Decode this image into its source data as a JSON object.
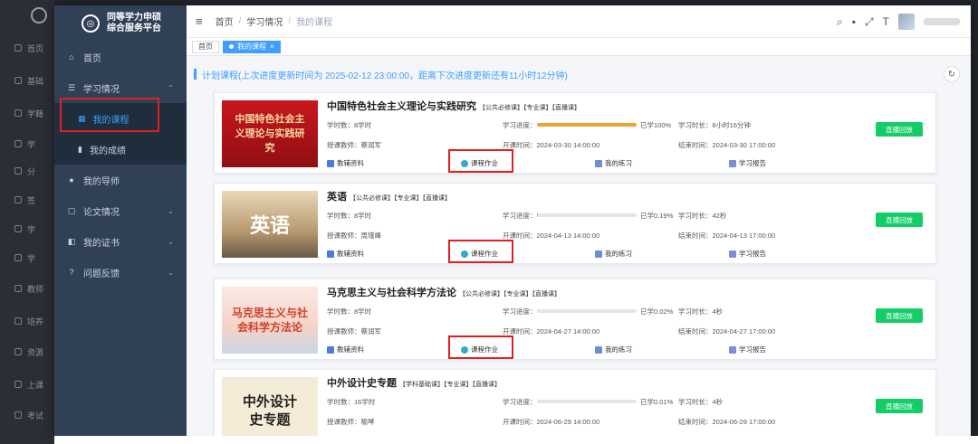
{
  "bg_sidebar": {
    "items": [
      "首页",
      "基础",
      "学籍",
      "学",
      "分",
      "签",
      "学",
      "学",
      "教师",
      "培养",
      "资源",
      "上课",
      "考试"
    ]
  },
  "sidebar": {
    "logo_text_line1": "同等学力申硕",
    "logo_text_line2": "综合服务平台",
    "menu": {
      "home": "首页",
      "study": "学习情况",
      "my_courses": "我的课程",
      "my_grades": "我的成绩",
      "my_tutor": "我的导师",
      "thesis": "论文情况",
      "certificates": "我的证书",
      "feedback": "问题反馈"
    }
  },
  "navbar": {
    "breadcrumb": [
      "首页",
      "学习情况",
      "我的课程"
    ]
  },
  "tags_view": {
    "home": "首页",
    "active": "我的课程"
  },
  "plan": {
    "text": "计划课程(上次进度更新时间为 2025-02-12 23:00:00，距离下次进度更新还有11小时12分钟)"
  },
  "labels": {
    "study_hours": "学时数：",
    "progress": "学习进度：",
    "duration": "学习时长：",
    "teacher": "授课教师：",
    "start": "开课时间：",
    "end": "结束时间：",
    "materials": "教辅资料",
    "homework": "课程作业",
    "exercise": "我的练习",
    "report": "学习报告",
    "replay": "直播回放"
  },
  "courses": [
    {
      "title": "中国特色社会主义理论与实践研究",
      "tags": "【公共必修课】【专业课】【直播课】",
      "thumb_text": "中国特色社会主义理论与实践研究",
      "hours": "8学时",
      "progress_text": "已学100%",
      "progress": 1.0,
      "duration": "6小时16分钟",
      "teacher": "蔡润军",
      "start": "2024-03-30 14:00:00",
      "end": "2024-03-30 17:00:00"
    },
    {
      "title": "英语",
      "tags": "【公共必修课】【专业课】【直播课】",
      "thumb_text": "英语",
      "hours": "8学时",
      "progress_text": "已学0.19%",
      "progress": 0.0019,
      "duration": "42秒",
      "teacher": "周瑾峰",
      "start": "2024-04-13 14:00:00",
      "end": "2024-04-13 17:00:00"
    },
    {
      "title": "马克思主义与社会科学方法论",
      "tags": "【公共必修课】【专业课】【直播课】",
      "thumb_text": "马克思主义与社会科学方法论",
      "hours": "8学时",
      "progress_text": "已学0.02%",
      "progress": 0.0002,
      "duration": "4秒",
      "teacher": "蔡润军",
      "start": "2024-04-27 14:00:00",
      "end": "2024-04-27 17:00:00"
    },
    {
      "title": "中外设计史专题",
      "tags": "【学科基础课】【专业课】【直播课】",
      "thumb_text": "中外设计史专题",
      "hours": "16学时",
      "progress_text": "已学0.01%",
      "progress": 0.0001,
      "duration": "4秒",
      "teacher": "喻琴",
      "start": "2024-06-29 14:00:00",
      "end": "2024-06-29 17:00:00"
    }
  ],
  "colors": {
    "sidebar_bg": "#304156",
    "accent": "#409eff",
    "highlight_red": "#e02020",
    "replay_green": "#13ce66",
    "progress_orange": "#f0a033"
  }
}
